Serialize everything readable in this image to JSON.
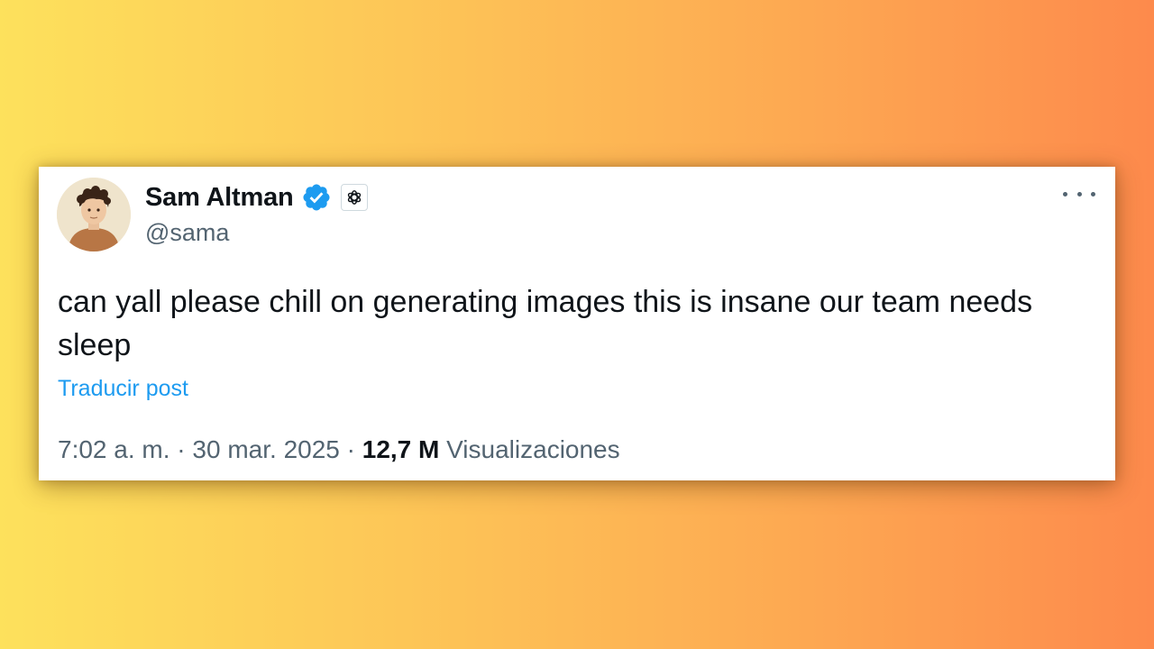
{
  "tweet": {
    "author": {
      "name": "Sam Altman",
      "handle": "@sama",
      "verified": true,
      "affiliate_icon": "openai-logo-icon"
    },
    "text": "can yall please chill on generating images this is insane our team needs sleep",
    "translate_label": "Traducir post",
    "time": "7:02 a. m.",
    "separator": "·",
    "date": "30 mar. 2025",
    "views_count": "12,7 M",
    "views_label": "Visualizaciones",
    "menu_icon": "more-options-icon"
  },
  "colors": {
    "background_gradient": [
      "#fde15c",
      "#fd8a4c"
    ],
    "link": "#1d9bf0",
    "verified": "#1d9bf0",
    "text_primary": "#0f1419",
    "text_secondary": "#536471"
  }
}
